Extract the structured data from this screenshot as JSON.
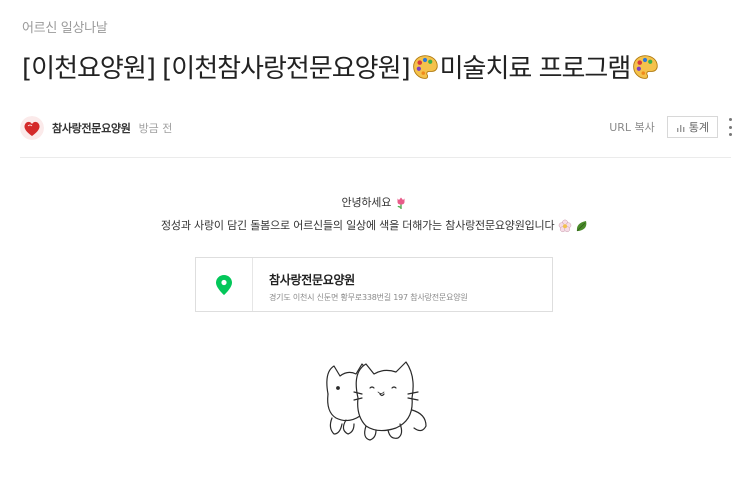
{
  "post": {
    "category": "어르신 일상나날",
    "title_text": "[이천요양원] [이천참사랑전문요양원] ",
    "title_suffix": "미술치료 프로그램",
    "title_emoji": "palette-icon"
  },
  "author": {
    "name": "참사랑전문요양원",
    "time": "방금 전"
  },
  "tools": {
    "url_copy": "URL 복사",
    "stats": "통계"
  },
  "content": {
    "line1": "안녕하세요",
    "line1_emoji": "tulip-icon",
    "line2": "정성과 사랑이 담긴 돌봄으로 어르신들의 일상에 색을 더해가는 참사랑전문요양원입니다",
    "line2_emojis": [
      "blossom-icon",
      "leaf-icon"
    ]
  },
  "place": {
    "name": "참사랑전문요양원",
    "address": "경기도 이천시 신둔면 황무로338번길 197 참사랑전문요양원",
    "pin_color": "#03c75a"
  },
  "sticker": "cat-sticker"
}
